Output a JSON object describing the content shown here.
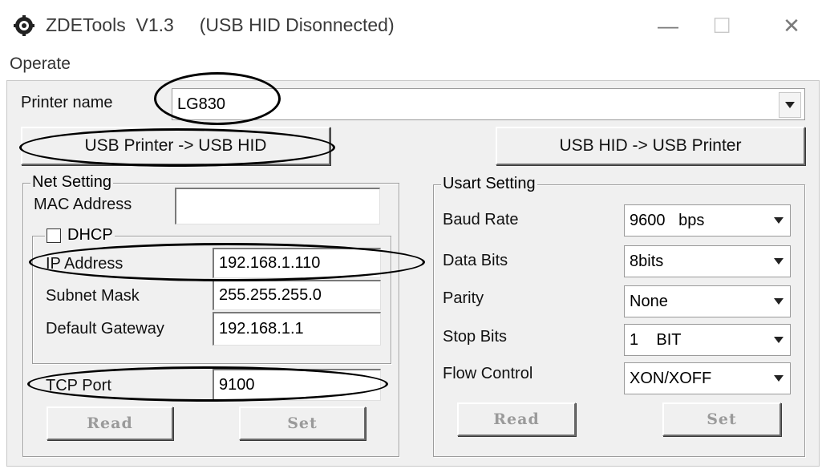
{
  "window": {
    "title": "ZDETools  V1.3     (USB HID Disonnected)",
    "minimize_glyph": "—",
    "maximize_glyph": "☐",
    "close_glyph": "✕"
  },
  "menu": {
    "operate": "Operate"
  },
  "printer": {
    "label": "Printer name",
    "value": "LG830",
    "usb_to_hid": "USB Printer -> USB HID",
    "hid_to_usb": "USB HID -> USB Printer"
  },
  "net": {
    "title": "Net Setting",
    "mac_label": "MAC Address",
    "mac_value": "",
    "dhcp_label": "DHCP",
    "dhcp_checked": false,
    "ip_label": "IP Address",
    "ip_value": "192.168.1.110",
    "subnet_label": "Subnet Mask",
    "subnet_value": "255.255.255.0",
    "gateway_label": "Default Gateway",
    "gateway_value": "192.168.1.1",
    "port_label": "TCP Port",
    "port_value": "9100",
    "read": "Read",
    "set": "Set"
  },
  "usart": {
    "title": "Usart Setting",
    "baud_label": "Baud Rate",
    "baud_value": "9600   bps",
    "data_label": "Data Bits",
    "data_value": "8bits",
    "parity_label": "Parity",
    "parity_value": "None",
    "stop_label": "Stop Bits",
    "stop_value": "1    BIT",
    "flow_label": "Flow Control",
    "flow_value": "XON/XOFF",
    "read": "Read",
    "set": "Set"
  }
}
